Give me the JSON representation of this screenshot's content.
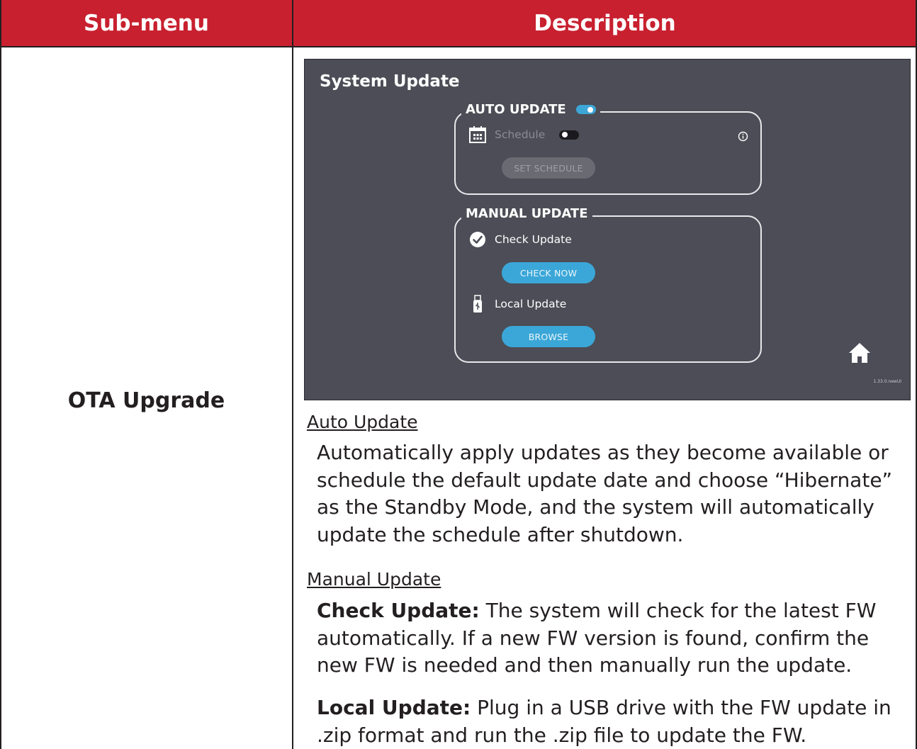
{
  "table": {
    "headers": {
      "submenu": "Sub-menu",
      "description": "Description"
    },
    "colors": {
      "header_bg": "#c8202f",
      "header_text": "#ffffff"
    }
  },
  "row": {
    "submenu_name": "OTA Upgrade"
  },
  "screenshot": {
    "title": "System Update",
    "auto_update": {
      "label": "AUTO UPDATE",
      "toggle_on": true,
      "schedule_label": "Schedule",
      "schedule_toggle_on": false,
      "set_schedule_button": "SET SCHEDULE"
    },
    "manual_update": {
      "label": "MANUAL UPDATE",
      "check_update_label": "Check Update",
      "check_now_button": "CHECK NOW",
      "local_update_label": "Local Update",
      "browse_button": "BROWSE"
    },
    "version": "1.33.0.newUI",
    "colors": {
      "panel_bg": "#4c4d56",
      "accent": "#3ba7d8"
    }
  },
  "description": {
    "auto_heading": "Auto Update",
    "auto_body": "Automatically apply updates as they become available or schedule the default update date and choose “Hibernate” as the Standby Mode, and the system will automatically update the schedule after shutdown.",
    "manual_heading": "Manual Update",
    "check_update_term": "Check Update:",
    "check_update_body": " The system will check for the latest FW automatically. If a new FW version is found, confirm the new FW is needed and then manually run the update.",
    "local_update_term": "Local Update:",
    "local_update_body": " Plug in a USB drive with the FW update in .zip format and run the .zip file to update the FW."
  }
}
